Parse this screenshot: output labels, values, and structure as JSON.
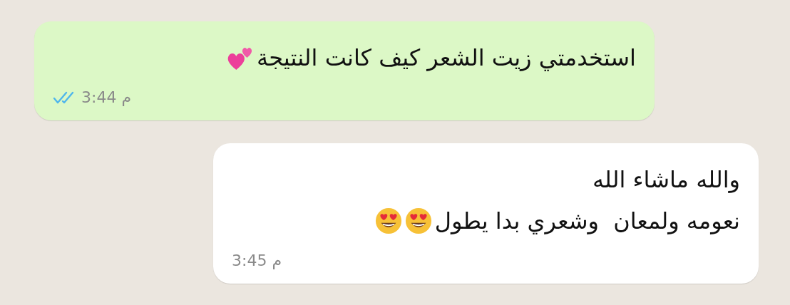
{
  "messages": [
    {
      "kind": "outgoing",
      "lines": [
        "استخدمتي زيت الشعر كيف كانت النتيجة"
      ],
      "emoji": [
        {
          "kind": "two_hearts"
        }
      ],
      "time": "م 3:44",
      "read": true
    },
    {
      "kind": "incoming",
      "lines": [
        "والله ماشاء الله",
        "نعومه ولمعان  وشعري بدا يطول"
      ],
      "emoji": [
        {
          "kind": "heart_eyes"
        },
        {
          "kind": "heart_eyes"
        }
      ],
      "time": "م 3:45"
    }
  ]
}
